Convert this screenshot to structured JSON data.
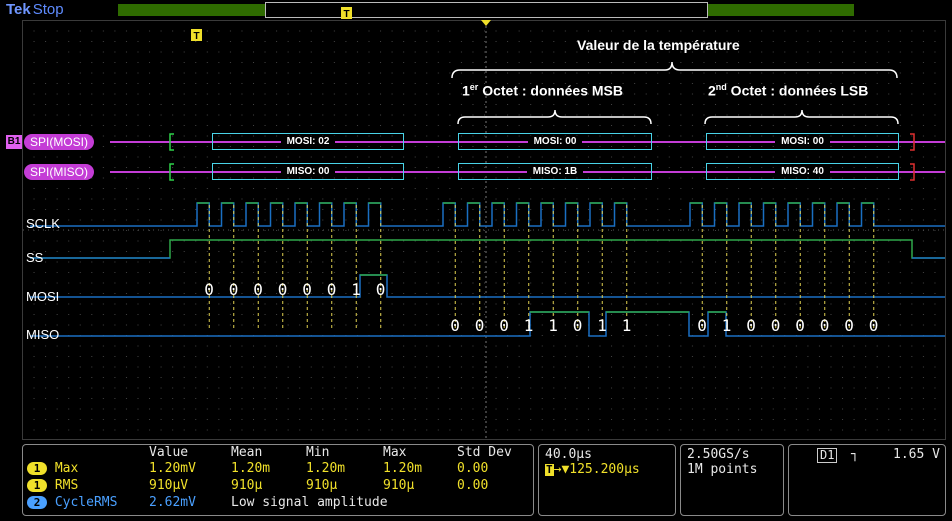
{
  "topbar": {
    "brand": "Tek",
    "state": "Stop",
    "trigger_marker": "T"
  },
  "colors": {
    "bus": "#c43cd6",
    "decode_box": "#49d3e8",
    "digital_trace": "#1a6fc2",
    "clock_trace": "#2fa84a",
    "cursor_dash": "#e0d050",
    "measurement": "#f0e02a",
    "measurement_ch2": "#4aa0ff",
    "record_bar": "#2f6b00"
  },
  "annotations": {
    "title": "Valeur de la température",
    "byte1_prefix": "1",
    "byte1_sup": "er",
    "byte1_text": " Octet :  données MSB",
    "byte2_prefix": "2",
    "byte2_sup": "nd",
    "byte2_text": " Octet :  données LSB"
  },
  "buses": {
    "b1_tag": "B1",
    "mosi_label": "SPI(MOSI)",
    "miso_label": "SPI(MISO)",
    "mosi_packets": [
      "MOSI: 02",
      "MOSI: 00",
      "MOSI: 00"
    ],
    "miso_packets": [
      "MISO: 00",
      "MISO: 1B",
      "MISO: 40"
    ]
  },
  "channels": {
    "sclk": "SCLK",
    "ss": "SS",
    "mosi": "MOSI",
    "miso": "MISO"
  },
  "bits": {
    "mosi_byte": [
      "0",
      "0",
      "0",
      "0",
      "0",
      "0",
      "1",
      "0"
    ],
    "miso_byte1": [
      "0",
      "0",
      "0",
      "1",
      "1",
      "0",
      "1",
      "1"
    ],
    "miso_byte2": [
      "0",
      "1",
      "0",
      "0",
      "0",
      "0",
      "0",
      "0"
    ]
  },
  "measurements": {
    "headers": [
      "Value",
      "Mean",
      "Min",
      "Max",
      "Std Dev"
    ],
    "rows": [
      {
        "chip": "1",
        "name": "Max",
        "values": [
          "1.20mV",
          "1.20m",
          "1.20m",
          "1.20m",
          "0.00"
        ]
      },
      {
        "chip": "1",
        "name": "RMS",
        "values": [
          "910µV",
          "910µ",
          "910µ",
          "910µ",
          "0.00"
        ]
      },
      {
        "chip": "2",
        "name": "CycleRMS",
        "values": [
          "2.62mV",
          "Low signal amplitude"
        ]
      }
    ]
  },
  "timebase": {
    "scale": "40.0µs",
    "trigger_pos": "→▼125.200µs",
    "trigger_chip": "T"
  },
  "acquisition": {
    "rate": "2.50GS/s",
    "points": "1M points"
  },
  "trigger": {
    "source": "D1",
    "slope": "┐",
    "level": "1.65 V"
  }
}
